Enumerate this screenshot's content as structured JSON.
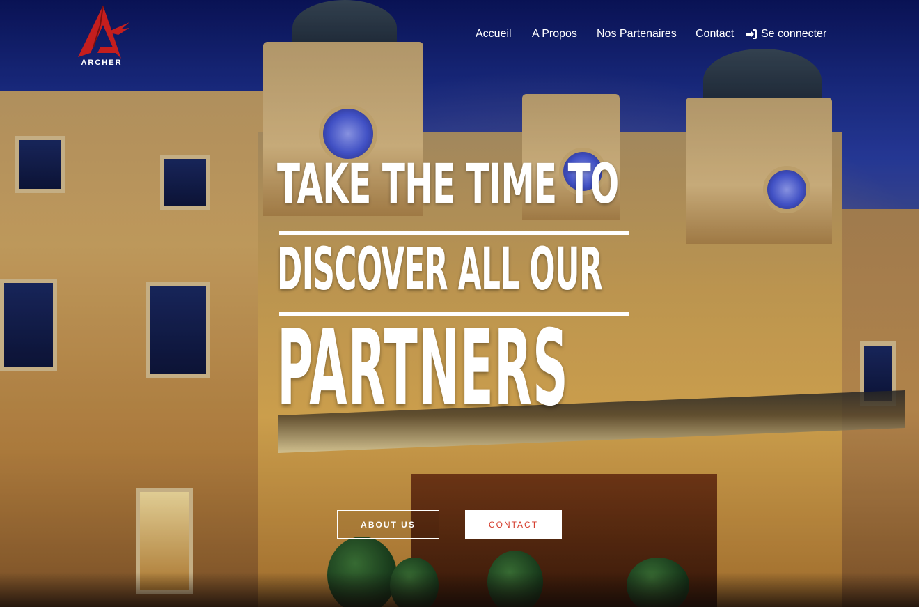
{
  "brand": {
    "name": "ARCHER",
    "logo_color": "#c41e1e"
  },
  "nav": {
    "items": [
      {
        "label": "Accueil"
      },
      {
        "label": "A Propos"
      },
      {
        "label": "Nos Partenaires"
      },
      {
        "label": "Contact"
      }
    ],
    "login": {
      "label": "Se connecter",
      "icon": "sign-in-icon"
    }
  },
  "hero": {
    "line1": "TAKE THE TIME TO",
    "line2": "DISCOVER ALL OUR",
    "line3": "PARTNERS",
    "buttons": {
      "about": "ABOUT US",
      "contact": "CONTACT"
    },
    "accent_color": "#d43a2a"
  }
}
